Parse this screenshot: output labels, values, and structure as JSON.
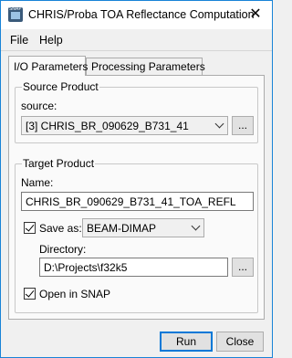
{
  "window": {
    "title": "CHRIS/Proba TOA Reflectance Computation",
    "close_glyph": "✕",
    "app_icon_text": "SNAP"
  },
  "menu": {
    "items": [
      {
        "label": "File"
      },
      {
        "label": "Help"
      }
    ]
  },
  "tabs": [
    {
      "label": "I/O Parameters",
      "active": true
    },
    {
      "label": "Processing Parameters",
      "active": false
    }
  ],
  "source_product": {
    "group_title": "Source Product",
    "source_label": "source:",
    "source_value": "[3] CHRIS_BR_090629_B731_41",
    "browse_label": "..."
  },
  "target_product": {
    "group_title": "Target Product",
    "name_label": "Name:",
    "name_value": "CHRIS_BR_090629_B731_41_TOA_REFL",
    "save_as_label": "Save as:",
    "save_as_checked": true,
    "format_value": "BEAM-DIMAP",
    "directory_label": "Directory:",
    "directory_value": "D:\\Projects\\f32k5",
    "browse_label": "...",
    "open_in_snap_label": "Open in SNAP",
    "open_in_snap_checked": true
  },
  "buttons": {
    "run_label": "Run",
    "close_label": "Close"
  },
  "colors": {
    "window_border": "#1883d7",
    "default_button_border": "#0078d7"
  }
}
